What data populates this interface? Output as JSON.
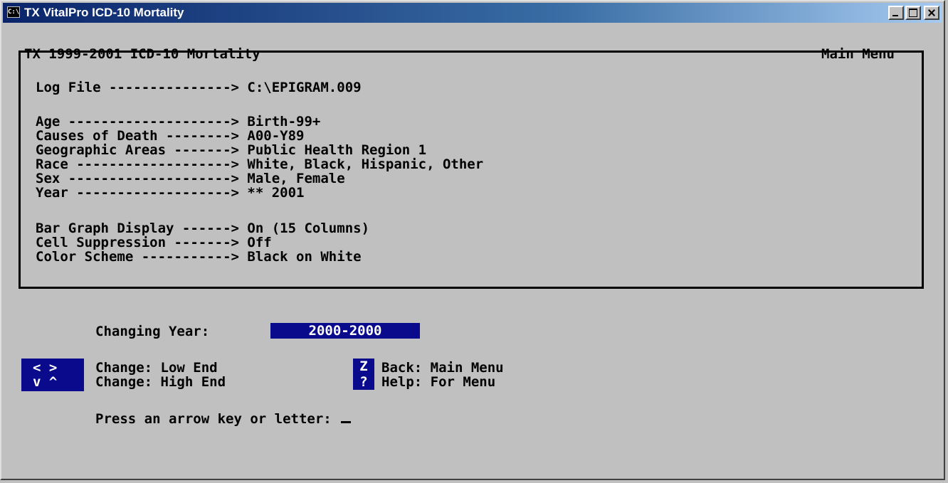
{
  "window": {
    "title": "TX VitalPro ICD-10 Mortality",
    "icon": "console-icon"
  },
  "header": {
    "left": "TX 1999-2001 ICD-10 Mortality",
    "right": "Main Menu"
  },
  "settings": [
    {
      "label": "Log File ---------------> ",
      "value": "C:\\EPIGRAM.009"
    },
    {
      "label": "Age --------------------> ",
      "value": "Birth-99+"
    },
    {
      "label": "Causes of Death --------> ",
      "value": "A00-Y89"
    },
    {
      "label": "Geographic Areas -------> ",
      "value": "Public Health Region 1"
    },
    {
      "label": "Race -------------------> ",
      "value": "White, Black, Hispanic, Other"
    },
    {
      "label": "Sex --------------------> ",
      "value": "Male, Female"
    },
    {
      "label": "Year -------------------> ",
      "value": "** 2001"
    },
    {
      "label": "Bar Graph Display ------> ",
      "value": "On (15 Columns)"
    },
    {
      "label": "Cell Suppression -------> ",
      "value": "Off"
    },
    {
      "label": "Color Scheme -----------> ",
      "value": "Black on White"
    }
  ],
  "editor": {
    "label": "Changing Year:",
    "value": "2000-2000"
  },
  "keys": {
    "arrows_top": "< >",
    "arrows_bottom": "v ^",
    "low_end": "Change: Low End",
    "high_end": "Change: High End",
    "z_key": "Z",
    "help_key": "?",
    "back": "Back: Main Menu",
    "help": "Help: For Menu"
  },
  "prompt": "Press an arrow key or letter:",
  "colors": {
    "highlight_bg": "#0a0a8c",
    "console_bg": "#c0c0c0",
    "title_gradient_start": "#0a246a"
  }
}
